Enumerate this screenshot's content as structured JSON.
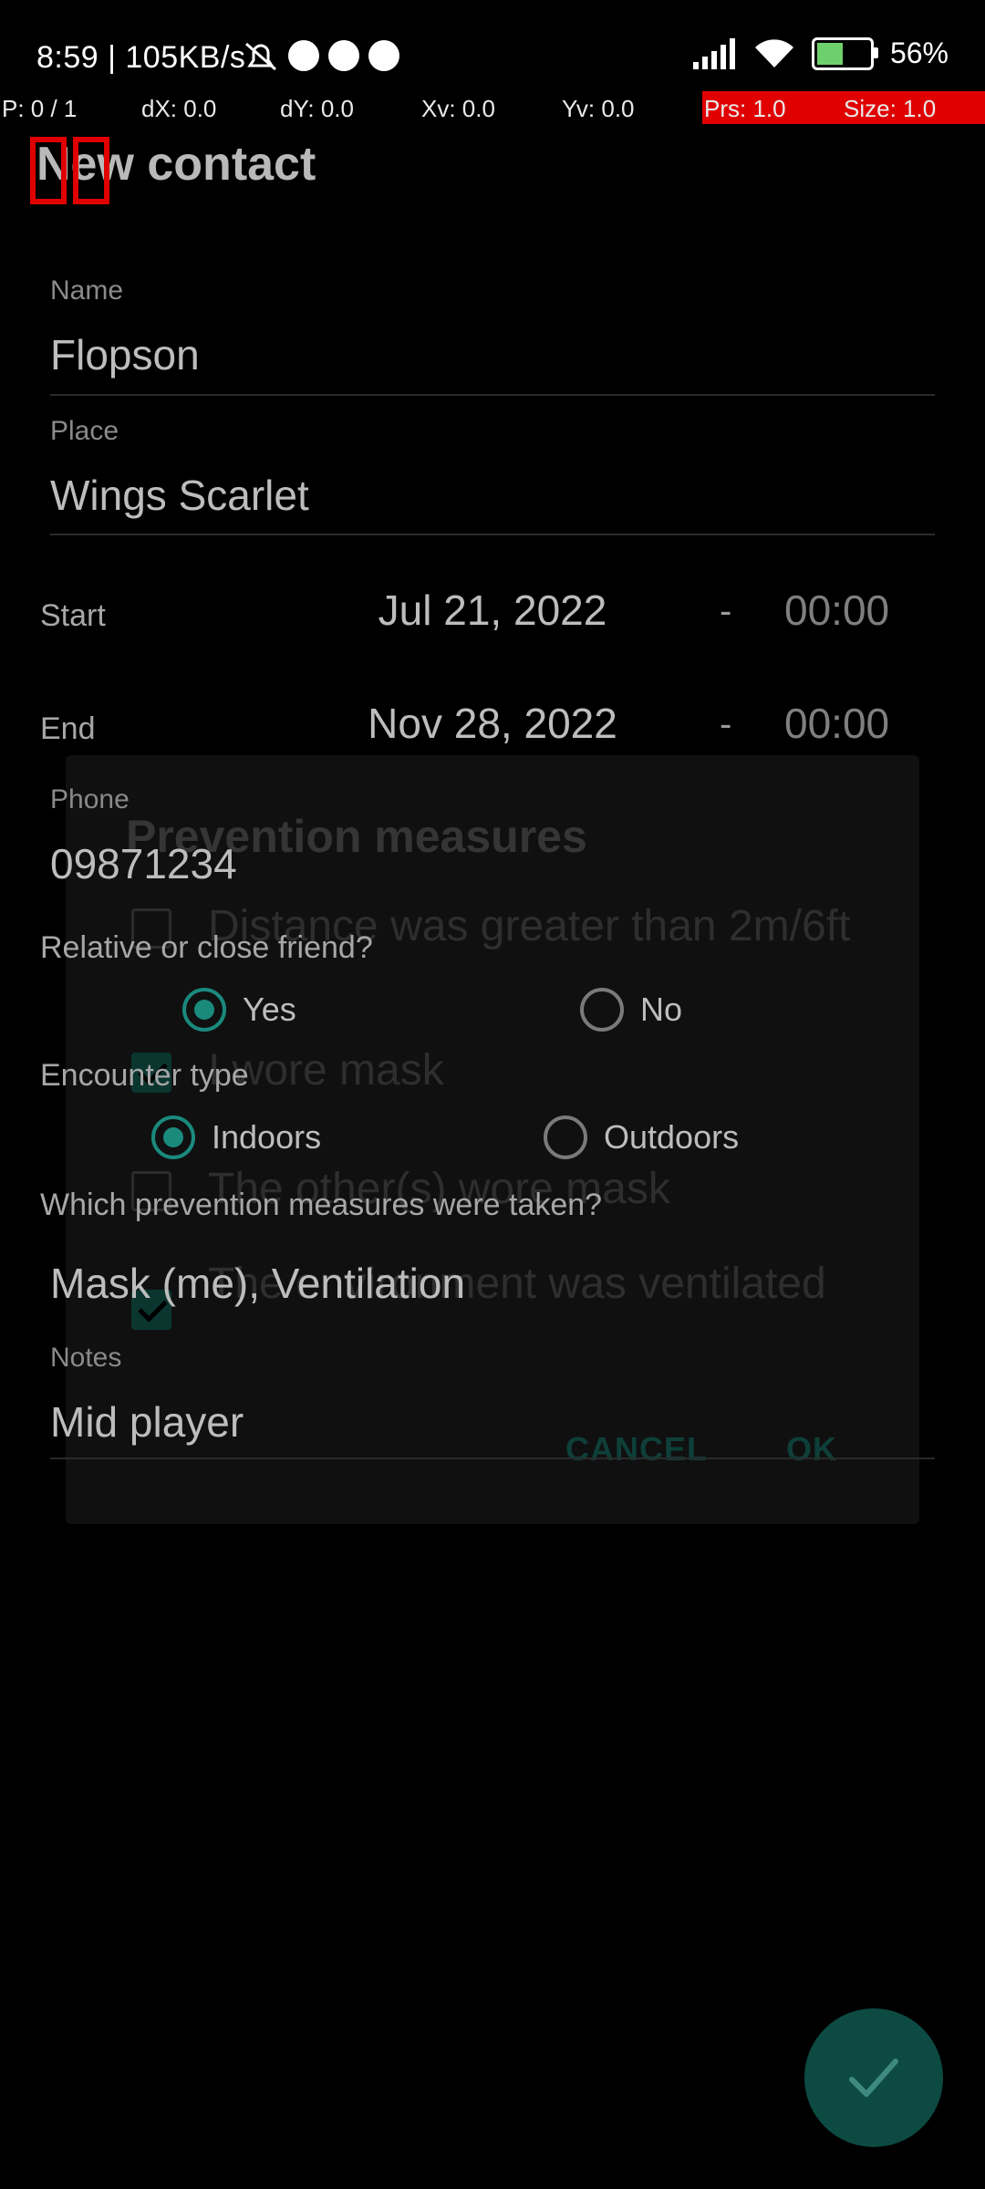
{
  "status_bar": {
    "time_speed": "8:59 | 105KB/s",
    "battery_pct": "56%"
  },
  "pointer_location": {
    "p": "P: 0 / 1",
    "dx": "dX: 0.0",
    "dy": "dY: 0.0",
    "xv": "Xv: 0.0",
    "yv": "Yv: 0.0",
    "prs": "Prs: 1.0",
    "size": "Size: 1.0"
  },
  "toolbar": {
    "title": "New contact"
  },
  "form": {
    "name_label": "Name",
    "name_value": "Flopson",
    "place_label": "Place",
    "place_value": "Wings Scarlet",
    "start_label": "Start",
    "start_date": "Jul 21, 2022",
    "start_time": "00:00",
    "end_label": "End",
    "end_date": "Nov 28, 2022",
    "end_time": "00:00",
    "dash": "-",
    "phone_label": "Phone",
    "phone_value": "09871234",
    "relative_label": "Relative or close friend?",
    "relative_yes": "Yes",
    "relative_no": "No",
    "encounter_label": "Encounter type",
    "encounter_indoors": "Indoors",
    "encounter_outdoors": "Outdoors",
    "prevention_label": "Which prevention measures were taken?",
    "prevention_value": "Mask (me), Ventilation",
    "notes_label": "Notes",
    "notes_value": "Mid player"
  },
  "dialog": {
    "title": "Prevention measures",
    "options": [
      {
        "label": "Distance was greater than 2m/6ft",
        "checked": false
      },
      {
        "label": "I wore mask",
        "checked": true
      },
      {
        "label": "The other(s) wore mask",
        "checked": false
      },
      {
        "label": "The environment was ventilated",
        "checked": true
      }
    ],
    "cancel": "CANCEL",
    "ok": "OK"
  },
  "colors": {
    "accent": "#1a8a7d",
    "fab": "#0c4a42",
    "debug_red": "#e00000"
  },
  "icons": {
    "fab": "check-icon"
  }
}
